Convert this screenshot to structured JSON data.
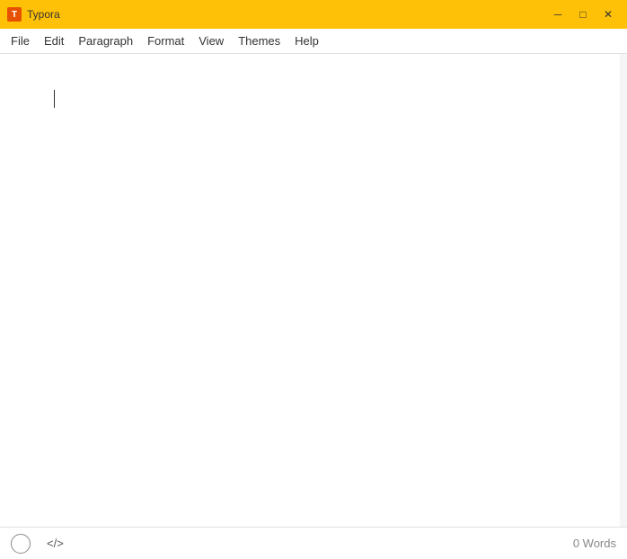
{
  "titleBar": {
    "appName": "Typora",
    "appIconLabel": "T",
    "minimizeLabel": "─",
    "maximizeLabel": "□",
    "closeLabel": "✕"
  },
  "menuBar": {
    "items": [
      {
        "label": "File"
      },
      {
        "label": "Edit"
      },
      {
        "label": "Paragraph"
      },
      {
        "label": "Format"
      },
      {
        "label": "View"
      },
      {
        "label": "Themes"
      },
      {
        "label": "Help"
      }
    ]
  },
  "statusBar": {
    "circleTitle": "focus-mode",
    "sourceLabel": "</>",
    "wordCount": "0 Words"
  }
}
